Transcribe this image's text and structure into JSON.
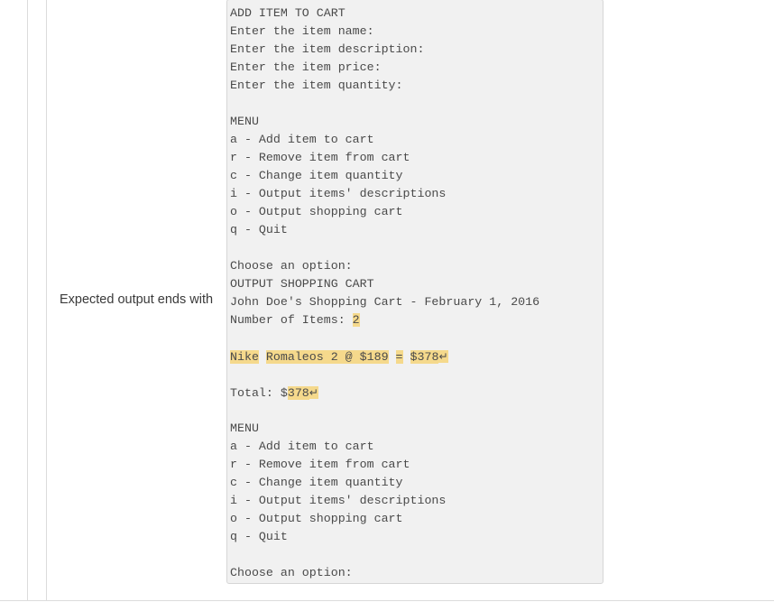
{
  "row": {
    "label": "Expected output ends with"
  },
  "console": {
    "lines": [
      {
        "segments": [
          {
            "text": "ADD ITEM TO CART",
            "highlight": false
          }
        ]
      },
      {
        "segments": [
          {
            "text": "Enter the item name:",
            "highlight": false
          }
        ]
      },
      {
        "segments": [
          {
            "text": "Enter the item description:",
            "highlight": false
          }
        ]
      },
      {
        "segments": [
          {
            "text": "Enter the item price:",
            "highlight": false
          }
        ]
      },
      {
        "segments": [
          {
            "text": "Enter the item quantity:",
            "highlight": false
          }
        ]
      },
      {
        "segments": [
          {
            "text": "",
            "highlight": false
          }
        ]
      },
      {
        "segments": [
          {
            "text": "MENU",
            "highlight": false
          }
        ]
      },
      {
        "segments": [
          {
            "text": "a - Add item to cart",
            "highlight": false
          }
        ]
      },
      {
        "segments": [
          {
            "text": "r - Remove item from cart",
            "highlight": false
          }
        ]
      },
      {
        "segments": [
          {
            "text": "c - Change item quantity",
            "highlight": false
          }
        ]
      },
      {
        "segments": [
          {
            "text": "i - Output items' descriptions",
            "highlight": false
          }
        ]
      },
      {
        "segments": [
          {
            "text": "o - Output shopping cart",
            "highlight": false
          }
        ]
      },
      {
        "segments": [
          {
            "text": "q - Quit",
            "highlight": false
          }
        ]
      },
      {
        "segments": [
          {
            "text": "",
            "highlight": false
          }
        ]
      },
      {
        "segments": [
          {
            "text": "Choose an option:",
            "highlight": false
          }
        ]
      },
      {
        "segments": [
          {
            "text": "OUTPUT SHOPPING CART",
            "highlight": false
          }
        ]
      },
      {
        "segments": [
          {
            "text": "John Doe's Shopping Cart - February 1, 2016",
            "highlight": false
          }
        ]
      },
      {
        "segments": [
          {
            "text": "Number of Items: ",
            "highlight": false
          },
          {
            "text": "2",
            "highlight": true
          }
        ]
      },
      {
        "segments": [
          {
            "text": "",
            "highlight": false
          }
        ]
      },
      {
        "segments": [
          {
            "text": "Nike",
            "highlight": true
          },
          {
            "text": " ",
            "highlight": false
          },
          {
            "text": "Romaleos 2 @ $189",
            "highlight": true
          },
          {
            "text": " ",
            "highlight": false
          },
          {
            "text": "=",
            "highlight": true
          },
          {
            "text": " ",
            "highlight": false
          },
          {
            "text": "$378",
            "highlight": true
          },
          {
            "text": "↵",
            "highlight": true,
            "glyph": "carriage-return"
          }
        ]
      },
      {
        "segments": [
          {
            "text": "",
            "highlight": false
          }
        ]
      },
      {
        "segments": [
          {
            "text": "Total: $",
            "highlight": false
          },
          {
            "text": "378",
            "highlight": true
          },
          {
            "text": "↵",
            "highlight": true,
            "glyph": "carriage-return"
          }
        ]
      },
      {
        "segments": [
          {
            "text": "",
            "highlight": false
          }
        ]
      },
      {
        "segments": [
          {
            "text": "MENU",
            "highlight": false
          }
        ]
      },
      {
        "segments": [
          {
            "text": "a - Add item to cart",
            "highlight": false
          }
        ]
      },
      {
        "segments": [
          {
            "text": "r - Remove item from cart",
            "highlight": false
          }
        ]
      },
      {
        "segments": [
          {
            "text": "c - Change item quantity",
            "highlight": false
          }
        ]
      },
      {
        "segments": [
          {
            "text": "i - Output items' descriptions",
            "highlight": false
          }
        ]
      },
      {
        "segments": [
          {
            "text": "o - Output shopping cart",
            "highlight": false
          }
        ]
      },
      {
        "segments": [
          {
            "text": "q - Quit",
            "highlight": false
          }
        ]
      },
      {
        "segments": [
          {
            "text": "",
            "highlight": false
          }
        ]
      },
      {
        "segments": [
          {
            "text": "Choose an option:",
            "highlight": false
          }
        ]
      }
    ]
  },
  "colors": {
    "panel_background": "#f1f1f1",
    "panel_border": "#d6d6d6",
    "highlight": "#f5d98c",
    "console_text": "#4a4a4a",
    "label_text": "#3a3a3a",
    "rule": "#dcdcdc"
  }
}
